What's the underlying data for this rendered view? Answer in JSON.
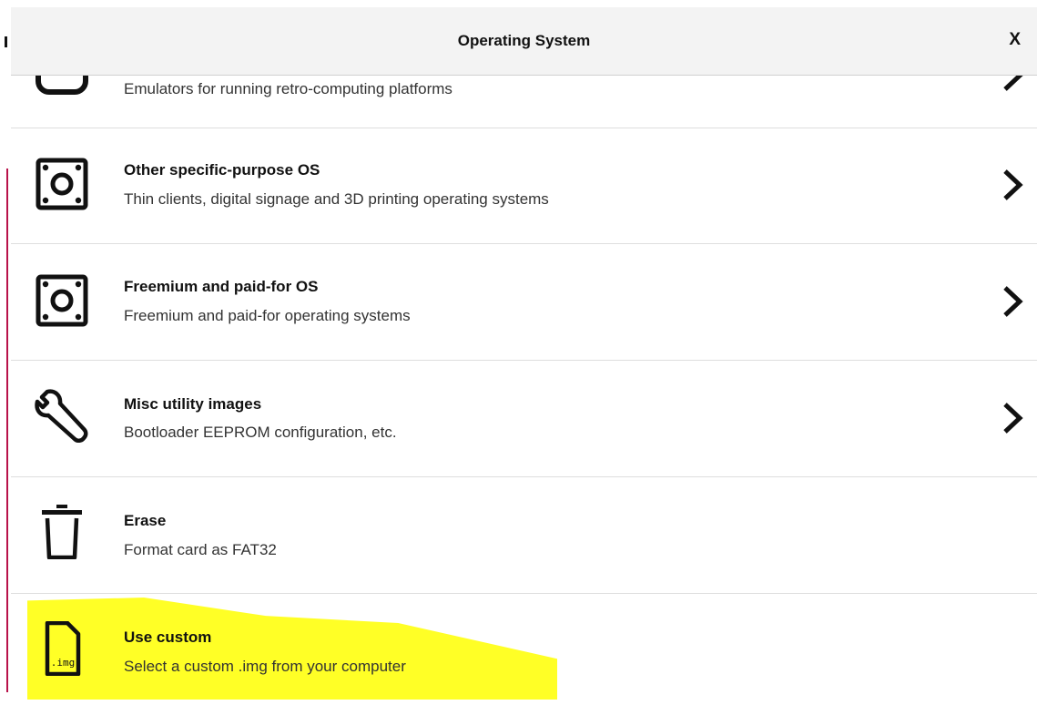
{
  "header": {
    "title": "Operating System",
    "close_label": "X"
  },
  "items": [
    {
      "title": "",
      "description": "Emulators for running retro-computing platforms",
      "icon": "gamepad-icon",
      "has_submenu": true
    },
    {
      "title": "Other specific-purpose OS",
      "description": "Thin clients, digital signage and 3D printing operating systems",
      "icon": "chip-icon",
      "has_submenu": true
    },
    {
      "title": "Freemium and paid-for OS",
      "description": "Freemium and paid-for operating systems",
      "icon": "chip-icon",
      "has_submenu": true
    },
    {
      "title": "Misc utility images",
      "description": "Bootloader EEPROM configuration, etc.",
      "icon": "wrench-icon",
      "has_submenu": true
    },
    {
      "title": "Erase",
      "description": "Format card as FAT32",
      "icon": "trash-icon",
      "has_submenu": false
    },
    {
      "title": "Use custom",
      "description": "Select a custom .img from your computer",
      "icon": "img-file-icon",
      "icon_label": ".img",
      "has_submenu": false
    }
  ],
  "colors": {
    "highlight": "#ffff00",
    "header_bg": "#f3f3f3",
    "accent_line": "#b8124a"
  }
}
